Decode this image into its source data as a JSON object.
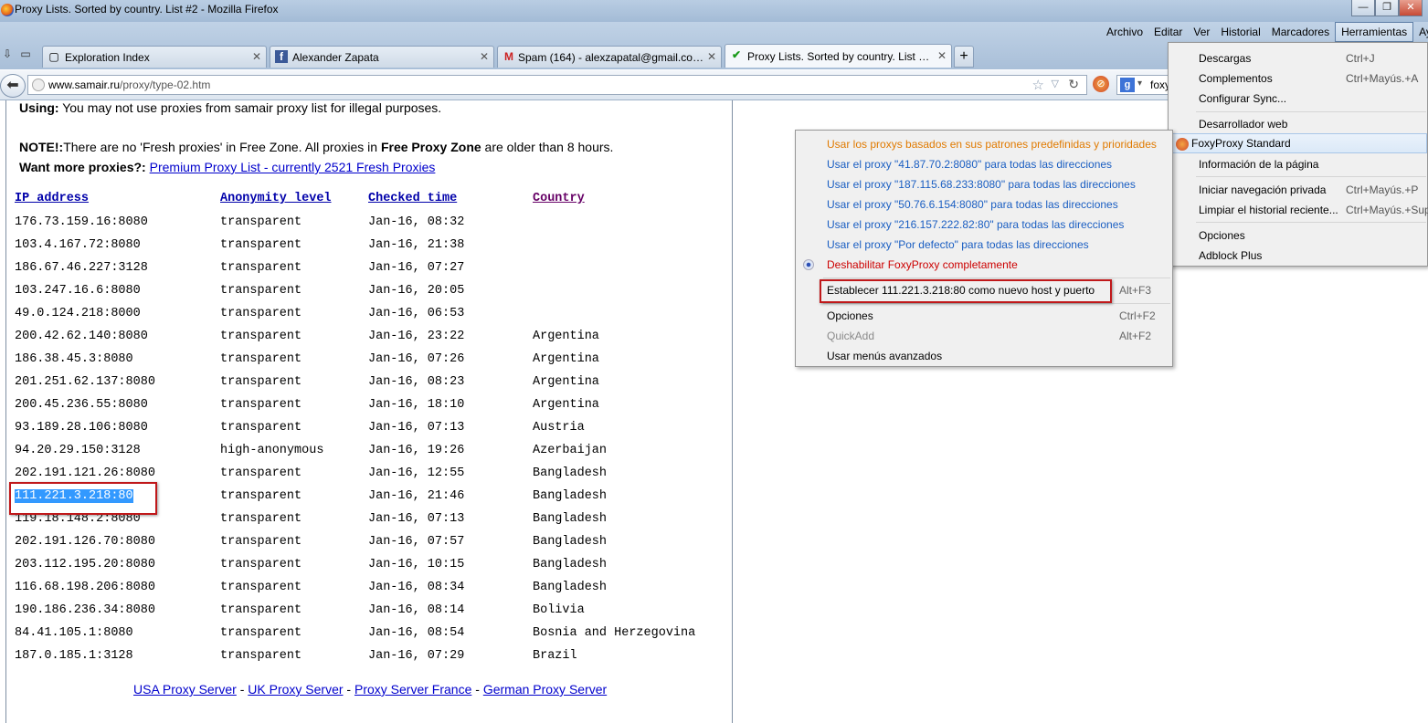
{
  "window": {
    "title": "Proxy Lists. Sorted by country. List #2 - Mozilla Firefox",
    "controls": [
      "—",
      "❐",
      "✕"
    ]
  },
  "tabs": [
    {
      "label": "Exploration Index",
      "favicon": "page-icon"
    },
    {
      "label": "Alexander Zapata",
      "favicon": "facebook-icon"
    },
    {
      "label": "Spam (164) - alexzapatal@gmail.com ...",
      "favicon": "gmail-icon"
    },
    {
      "label": "Proxy Lists. Sorted by country. List #2",
      "favicon": "checkmark-icon"
    }
  ],
  "menubar": [
    "Archivo",
    "Editar",
    "Ver",
    "Historial",
    "Marcadores",
    "Herramientas",
    "Ay"
  ],
  "navbar": {
    "url_domain": "www.samair.ru",
    "url_path": "/proxy/type-02.htm",
    "search_text": "foxy"
  },
  "page": {
    "using_label": "Using:",
    "using_text": " You may not use proxies from samair proxy list for illegal purposes.",
    "note_label": "NOTE!:",
    "note_text_1": "There are no 'Fresh proxies' in Free Zone. All proxies in ",
    "note_bold": "Free Proxy Zone",
    "note_text_2": " are older than 8 hours.",
    "more_label": "Want more proxies?:",
    "more_link": "Premium Proxy List - currently 2521 Fresh Proxies",
    "columns": [
      "IP address",
      "Anonymity level",
      "Checked time",
      "Country"
    ],
    "rows": [
      {
        "ip": "176.73.159.16:8080",
        "anon": "transparent",
        "time": "Jan-16, 08:32",
        "country": ""
      },
      {
        "ip": "103.4.167.72:8080",
        "anon": "transparent",
        "time": "Jan-16, 21:38",
        "country": ""
      },
      {
        "ip": "186.67.46.227:3128",
        "anon": "transparent",
        "time": "Jan-16, 07:27",
        "country": ""
      },
      {
        "ip": "103.247.16.6:8080",
        "anon": "transparent",
        "time": "Jan-16, 20:05",
        "country": ""
      },
      {
        "ip": "49.0.124.218:8000",
        "anon": "transparent",
        "time": "Jan-16, 06:53",
        "country": ""
      },
      {
        "ip": "200.42.62.140:8080",
        "anon": "transparent",
        "time": "Jan-16, 23:22",
        "country": "Argentina"
      },
      {
        "ip": "186.38.45.3:8080",
        "anon": "transparent",
        "time": "Jan-16, 07:26",
        "country": "Argentina"
      },
      {
        "ip": "201.251.62.137:8080",
        "anon": "transparent",
        "time": "Jan-16, 08:23",
        "country": "Argentina"
      },
      {
        "ip": "200.45.236.55:8080",
        "anon": "transparent",
        "time": "Jan-16, 18:10",
        "country": "Argentina"
      },
      {
        "ip": "93.189.28.106:8080",
        "anon": "transparent",
        "time": "Jan-16, 07:13",
        "country": "Austria"
      },
      {
        "ip": "94.20.29.150:3128",
        "anon": "high-anonymous",
        "time": "Jan-16, 19:26",
        "country": "Azerbaijan"
      },
      {
        "ip": "202.191.121.26:8080",
        "anon": "transparent",
        "time": "Jan-16, 12:55",
        "country": "Bangladesh"
      },
      {
        "ip": "111.221.3.218:80",
        "anon": "transparent",
        "time": "Jan-16, 21:46",
        "country": "Bangladesh"
      },
      {
        "ip": "119.18.148.2:8080",
        "anon": "transparent",
        "time": "Jan-16, 07:13",
        "country": "Bangladesh"
      },
      {
        "ip": "202.191.126.70:8080",
        "anon": "transparent",
        "time": "Jan-16, 07:57",
        "country": "Bangladesh"
      },
      {
        "ip": "203.112.195.20:8080",
        "anon": "transparent",
        "time": "Jan-16, 10:15",
        "country": "Bangladesh"
      },
      {
        "ip": "116.68.198.206:8080",
        "anon": "transparent",
        "time": "Jan-16, 08:34",
        "country": "Bangladesh"
      },
      {
        "ip": "190.186.236.34:8080",
        "anon": "transparent",
        "time": "Jan-16, 08:14",
        "country": "Bolivia"
      },
      {
        "ip": "84.41.105.1:8080",
        "anon": "transparent",
        "time": "Jan-16, 08:54",
        "country": "Bosnia and Herzegovina"
      },
      {
        "ip": "187.0.185.1:3128",
        "anon": "transparent",
        "time": "Jan-16, 07:29",
        "country": "Brazil"
      }
    ],
    "footer_links": [
      "USA Proxy Server",
      "UK Proxy Server",
      "Proxy Server France",
      "German Proxy Server"
    ],
    "footer_sep": " - "
  },
  "tools_menu": [
    {
      "label": "Descargas",
      "shortcut": "Ctrl+J"
    },
    {
      "label": "Complementos",
      "shortcut": "Ctrl+Mayús.+A"
    },
    {
      "label": "Configurar Sync...",
      "shortcut": ""
    },
    {
      "label": "Desarrollador web",
      "shortcut": ""
    },
    {
      "label": "FoxyProxy Standard",
      "shortcut": ""
    },
    {
      "label": "Información de la página",
      "shortcut": ""
    },
    {
      "label": "Iniciar navegación privada",
      "shortcut": "Ctrl+Mayús.+P"
    },
    {
      "label": "Limpiar el historial reciente...",
      "shortcut": "Ctrl+Mayús.+Sup"
    },
    {
      "label": "Opciones",
      "shortcut": ""
    },
    {
      "label": "Adblock Plus",
      "shortcut": ""
    }
  ],
  "foxy_menu": [
    {
      "label": "Usar los proxys basados en sus patrones predefinidas y prioridades",
      "shortcut": ""
    },
    {
      "label": "Usar el proxy \"41.87.70.2:8080\" para todas las direcciones",
      "shortcut": ""
    },
    {
      "label": "Usar el proxy \"187.115.68.233:8080\" para todas las direcciones",
      "shortcut": ""
    },
    {
      "label": "Usar el proxy \"50.76.6.154:8080\" para todas las direcciones",
      "shortcut": ""
    },
    {
      "label": "Usar el proxy \"216.157.222.82:80\" para todas las direcciones",
      "shortcut": ""
    },
    {
      "label": "Usar el proxy \"Por defecto\" para todas las direcciones",
      "shortcut": ""
    },
    {
      "label": "Deshabilitar FoxyProxy completamente",
      "shortcut": ""
    },
    {
      "label": "Establecer 111.221.3.218:80 como nuevo host y puerto",
      "shortcut": "Alt+F3"
    },
    {
      "label": "Opciones",
      "shortcut": "Ctrl+F2"
    },
    {
      "label": "QuickAdd",
      "shortcut": "Alt+F2"
    },
    {
      "label": "Usar menús avanzados",
      "shortcut": ""
    }
  ],
  "colors": {
    "link": "#0000cc",
    "selection": "#3399ff",
    "annotation_red": "#c0181a",
    "foxy_orange": "#e07a00",
    "foxy_blue": "#1a5ec2",
    "foxy_red": "#cc0000"
  }
}
